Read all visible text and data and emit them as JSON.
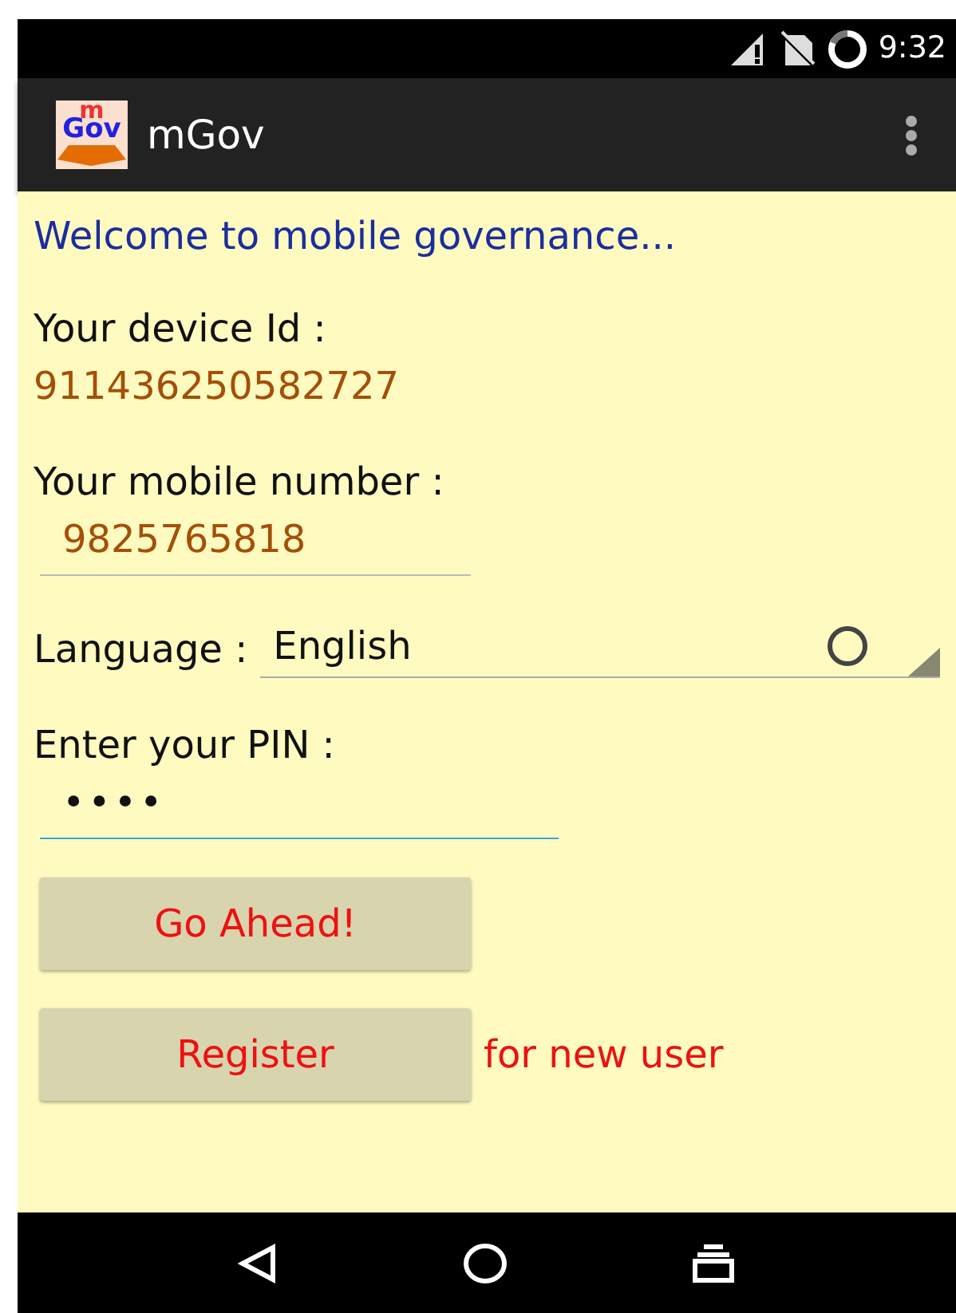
{
  "status_bar": {
    "time": "9:32"
  },
  "app_bar": {
    "logo_top": "m",
    "logo_bottom": "Gov",
    "title": "mGov"
  },
  "welcome": "Welcome to mobile governance...",
  "device": {
    "label": "Your device Id :",
    "value": "911436250582727"
  },
  "mobile": {
    "label": "Your mobile number :",
    "value": "9825765818"
  },
  "language": {
    "label": "Language :",
    "value": "English"
  },
  "pin": {
    "label": "Enter your PIN :",
    "value": "••••",
    "focused": true
  },
  "go_button": "Go Ahead!",
  "register": {
    "button": "Register",
    "note": "for new user"
  }
}
